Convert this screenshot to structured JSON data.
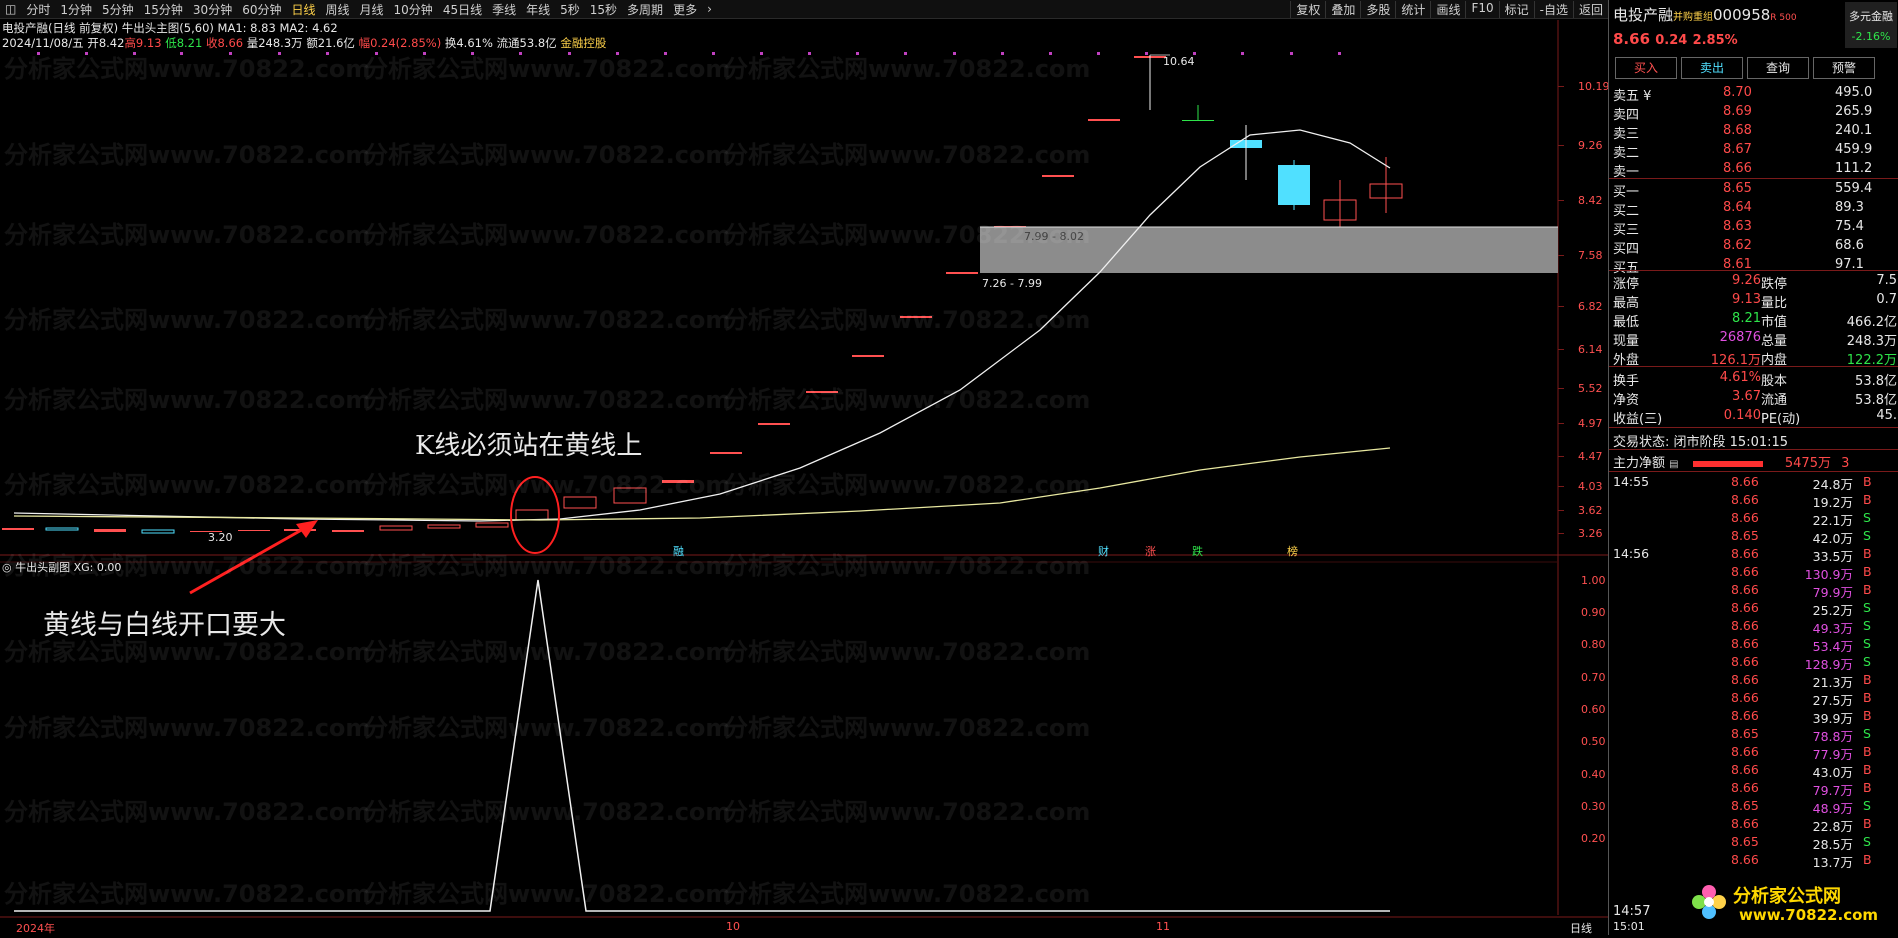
{
  "toolbar": {
    "tabs": [
      "分时",
      "1分钟",
      "5分钟",
      "15分钟",
      "30分钟",
      "60分钟",
      "日线",
      "周线",
      "月线",
      "10分钟",
      "45日线",
      "季线",
      "年线",
      "5秒",
      "15秒",
      "多周期",
      "更多"
    ],
    "active_index": 6,
    "right_tabs": [
      "复权",
      "叠加",
      "多股",
      "统计",
      "画线",
      "F10",
      "标记",
      "-自选",
      "返回"
    ]
  },
  "chart_header": {
    "stock": "电投产融(日线 前复权)",
    "indicator": "牛出头主图(5,60)",
    "ma1": "MA1: 8.83",
    "ma2": "MA2: 4.62",
    "date": "2024/11/08/五",
    "open": "开8.42",
    "high": "高9.13",
    "low": "低8.21",
    "close": "收8.66",
    "volume": "量248.3万",
    "amount": "额21.6亿",
    "change": "幅0.24(2.85%)",
    "turnover": "换4.61%",
    "float": "流通53.8亿",
    "tag": "金融控股"
  },
  "price_axis": [
    "10.19",
    "9.26",
    "8.42",
    "7.58",
    "6.82",
    "6.14",
    "5.52",
    "4.97",
    "4.47",
    "4.03",
    "3.62",
    "3.26"
  ],
  "sub_axis": [
    "1.00",
    "0.90",
    "0.80",
    "0.70",
    "0.60",
    "0.50",
    "0.40",
    "0.30",
    "0.20"
  ],
  "sub_header": "牛出头副图 XG: 0.00",
  "annotations": {
    "top": "K线必须站在黄线上",
    "bottom": "黄线与白线开口要大",
    "zone_upper": "7.99 - 8.02",
    "zone_lower": "7.26 - 7.99",
    "high_label": "10.64",
    "low_label": "3.20"
  },
  "time_axis": {
    "year": "2024年",
    "m10": "10",
    "m11": "11",
    "period": "日线"
  },
  "markers": [
    "融",
    "财",
    "涨",
    "跌",
    "榜"
  ],
  "watermark": "分析家公式网www.70822.com",
  "quote": {
    "name": "电投产融",
    "flag": "并购重组",
    "code": "000958",
    "badge": "R 500",
    "side_label": "多元金融",
    "side_change": "-2.16%",
    "price": "8.66",
    "change": "0.24",
    "pct": "2.85%",
    "buttons": [
      "买入",
      "卖出",
      "查询",
      "预警"
    ],
    "asks": [
      {
        "label": "卖五 ¥",
        "price": "8.70",
        "vol": "495.0"
      },
      {
        "label": "卖四",
        "price": "8.69",
        "vol": "265.9"
      },
      {
        "label": "卖三",
        "price": "8.68",
        "vol": "240.1"
      },
      {
        "label": "卖二",
        "price": "8.67",
        "vol": "459.9"
      },
      {
        "label": "卖一",
        "price": "8.66",
        "vol": "111.2"
      }
    ],
    "bids": [
      {
        "label": "买一",
        "price": "8.65",
        "vol": "559.4"
      },
      {
        "label": "买二",
        "price": "8.64",
        "vol": "89.3"
      },
      {
        "label": "买三",
        "price": "8.63",
        "vol": "75.4"
      },
      {
        "label": "买四",
        "price": "8.62",
        "vol": "68.6"
      },
      {
        "label": "买五",
        "price": "8.61",
        "vol": "97.1"
      }
    ],
    "stats": [
      {
        "k1": "涨停",
        "v1": "9.26",
        "k2": "跌停",
        "v2": "7.5"
      },
      {
        "k1": "最高",
        "v1": "9.13",
        "k2": "量比",
        "v2": "0.7"
      },
      {
        "k1": "最低",
        "v1": "8.21",
        "k2": "市值",
        "v2": "466.2亿"
      },
      {
        "k1": "现量",
        "v1": "26876",
        "k2": "总量",
        "v2": "248.3万"
      },
      {
        "k1": "外盘",
        "v1": "126.1万",
        "k2": "内盘",
        "v2": "122.2万"
      }
    ],
    "stats2": [
      {
        "k1": "换手",
        "v1": "4.61%",
        "k2": "股本",
        "v2": "53.8亿"
      },
      {
        "k1": "净资",
        "v1": "3.67",
        "k2": "流通",
        "v2": "53.8亿"
      },
      {
        "k1": "收益(三)",
        "v1": "0.140",
        "k2": "PE(动)",
        "v2": "45."
      }
    ],
    "status_label": "交易状态: 闭市阶段",
    "status_time": "15:01:15",
    "main_flow_label": "主力净额",
    "main_flow_value": "5475万",
    "main_flow_tail": "3",
    "ticks": [
      {
        "t": "14:55",
        "p": "8.66",
        "v": "24.8万",
        "s": "B"
      },
      {
        "t": "",
        "p": "8.66",
        "v": "19.2万",
        "s": "B"
      },
      {
        "t": "",
        "p": "8.66",
        "v": "22.1万",
        "s": "S"
      },
      {
        "t": "",
        "p": "8.65",
        "v": "42.0万",
        "s": "S"
      },
      {
        "t": "14:56",
        "p": "8.66",
        "v": "33.5万",
        "s": "B"
      },
      {
        "t": "",
        "p": "8.66",
        "v": "130.9万",
        "s": "B"
      },
      {
        "t": "",
        "p": "8.66",
        "v": "79.9万",
        "s": "B"
      },
      {
        "t": "",
        "p": "8.66",
        "v": "25.2万",
        "s": "S"
      },
      {
        "t": "",
        "p": "8.66",
        "v": "49.3万",
        "s": "S"
      },
      {
        "t": "",
        "p": "8.66",
        "v": "53.4万",
        "s": "S"
      },
      {
        "t": "",
        "p": "8.66",
        "v": "128.9万",
        "s": "S"
      },
      {
        "t": "",
        "p": "8.66",
        "v": "21.3万",
        "s": "B"
      },
      {
        "t": "",
        "p": "8.66",
        "v": "27.5万",
        "s": "B"
      },
      {
        "t": "",
        "p": "8.66",
        "v": "39.9万",
        "s": "B"
      },
      {
        "t": "",
        "p": "8.65",
        "v": "78.8万",
        "s": "S"
      },
      {
        "t": "",
        "p": "8.66",
        "v": "77.9万",
        "s": "B"
      },
      {
        "t": "",
        "p": "8.66",
        "v": "43.0万",
        "s": "B"
      },
      {
        "t": "",
        "p": "8.66",
        "v": "79.7万",
        "s": "B"
      },
      {
        "t": "",
        "p": "8.65",
        "v": "48.9万",
        "s": "S"
      },
      {
        "t": "",
        "p": "8.66",
        "v": "22.8万",
        "s": "B"
      },
      {
        "t": "",
        "p": "8.65",
        "v": "28.5万",
        "s": "S"
      },
      {
        "t": "",
        "p": "8.66",
        "v": "13.7万",
        "s": "B"
      }
    ],
    "tick_time_bottom": "14:57",
    "tick_time_bottom2": "15:01"
  },
  "logo": {
    "brand": "分析家公式网",
    "url": "www.70822.com"
  }
}
